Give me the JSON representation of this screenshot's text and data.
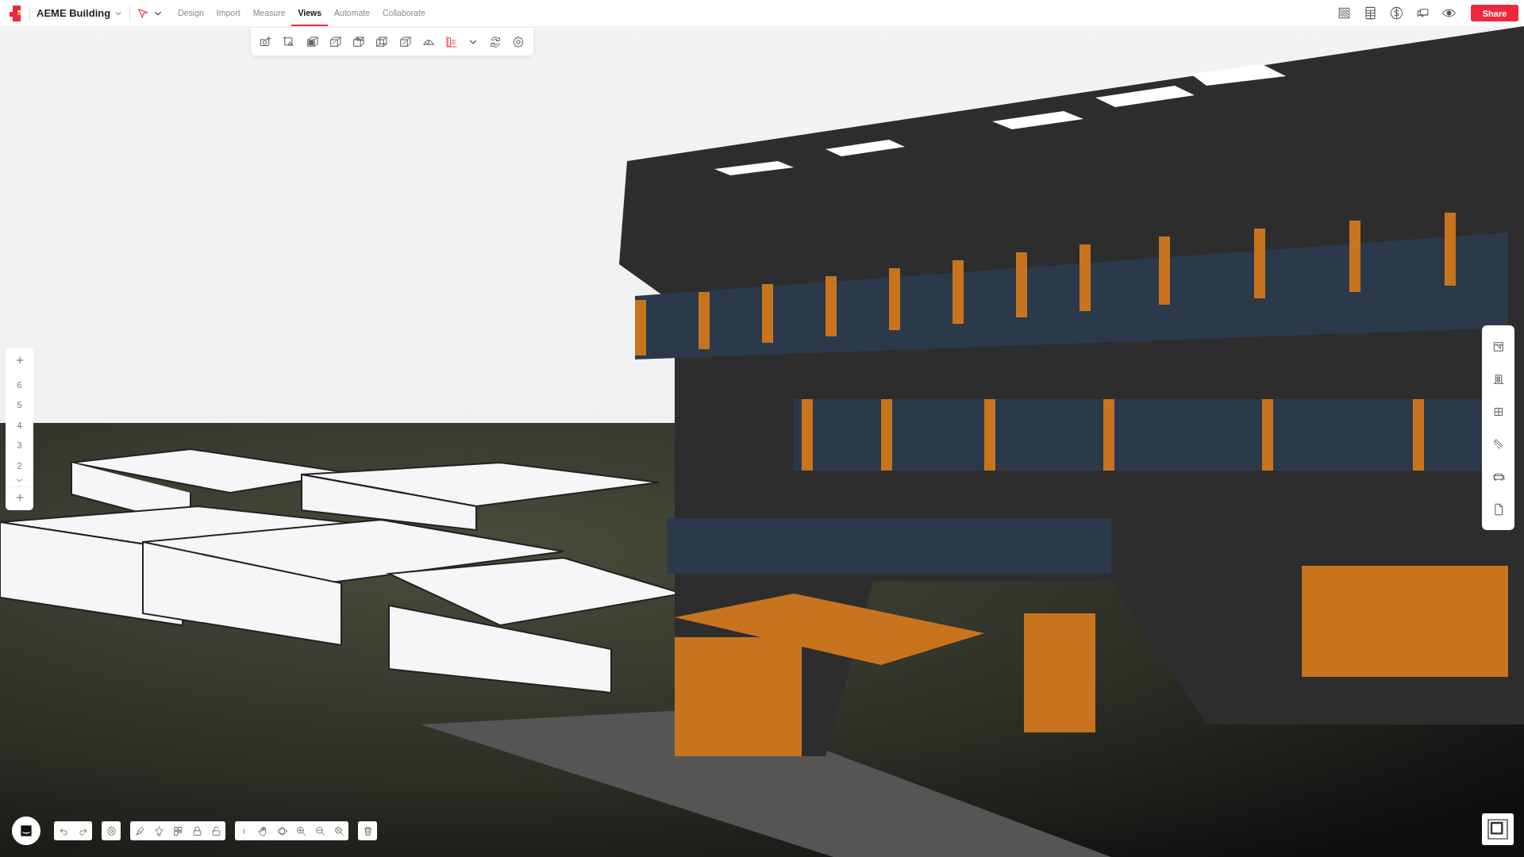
{
  "project": {
    "name": "AEME Building"
  },
  "menu_tabs": [
    {
      "label": "Design",
      "selected": false
    },
    {
      "label": "Import",
      "selected": false
    },
    {
      "label": "Measure",
      "selected": false
    },
    {
      "label": "Views",
      "selected": true
    },
    {
      "label": "Automate",
      "selected": false
    },
    {
      "label": "Collaborate",
      "selected": false
    }
  ],
  "share_button": {
    "label": "Share"
  },
  "level_panel": {
    "levels": [
      "6",
      "5",
      "4",
      "3",
      "2"
    ]
  }
}
